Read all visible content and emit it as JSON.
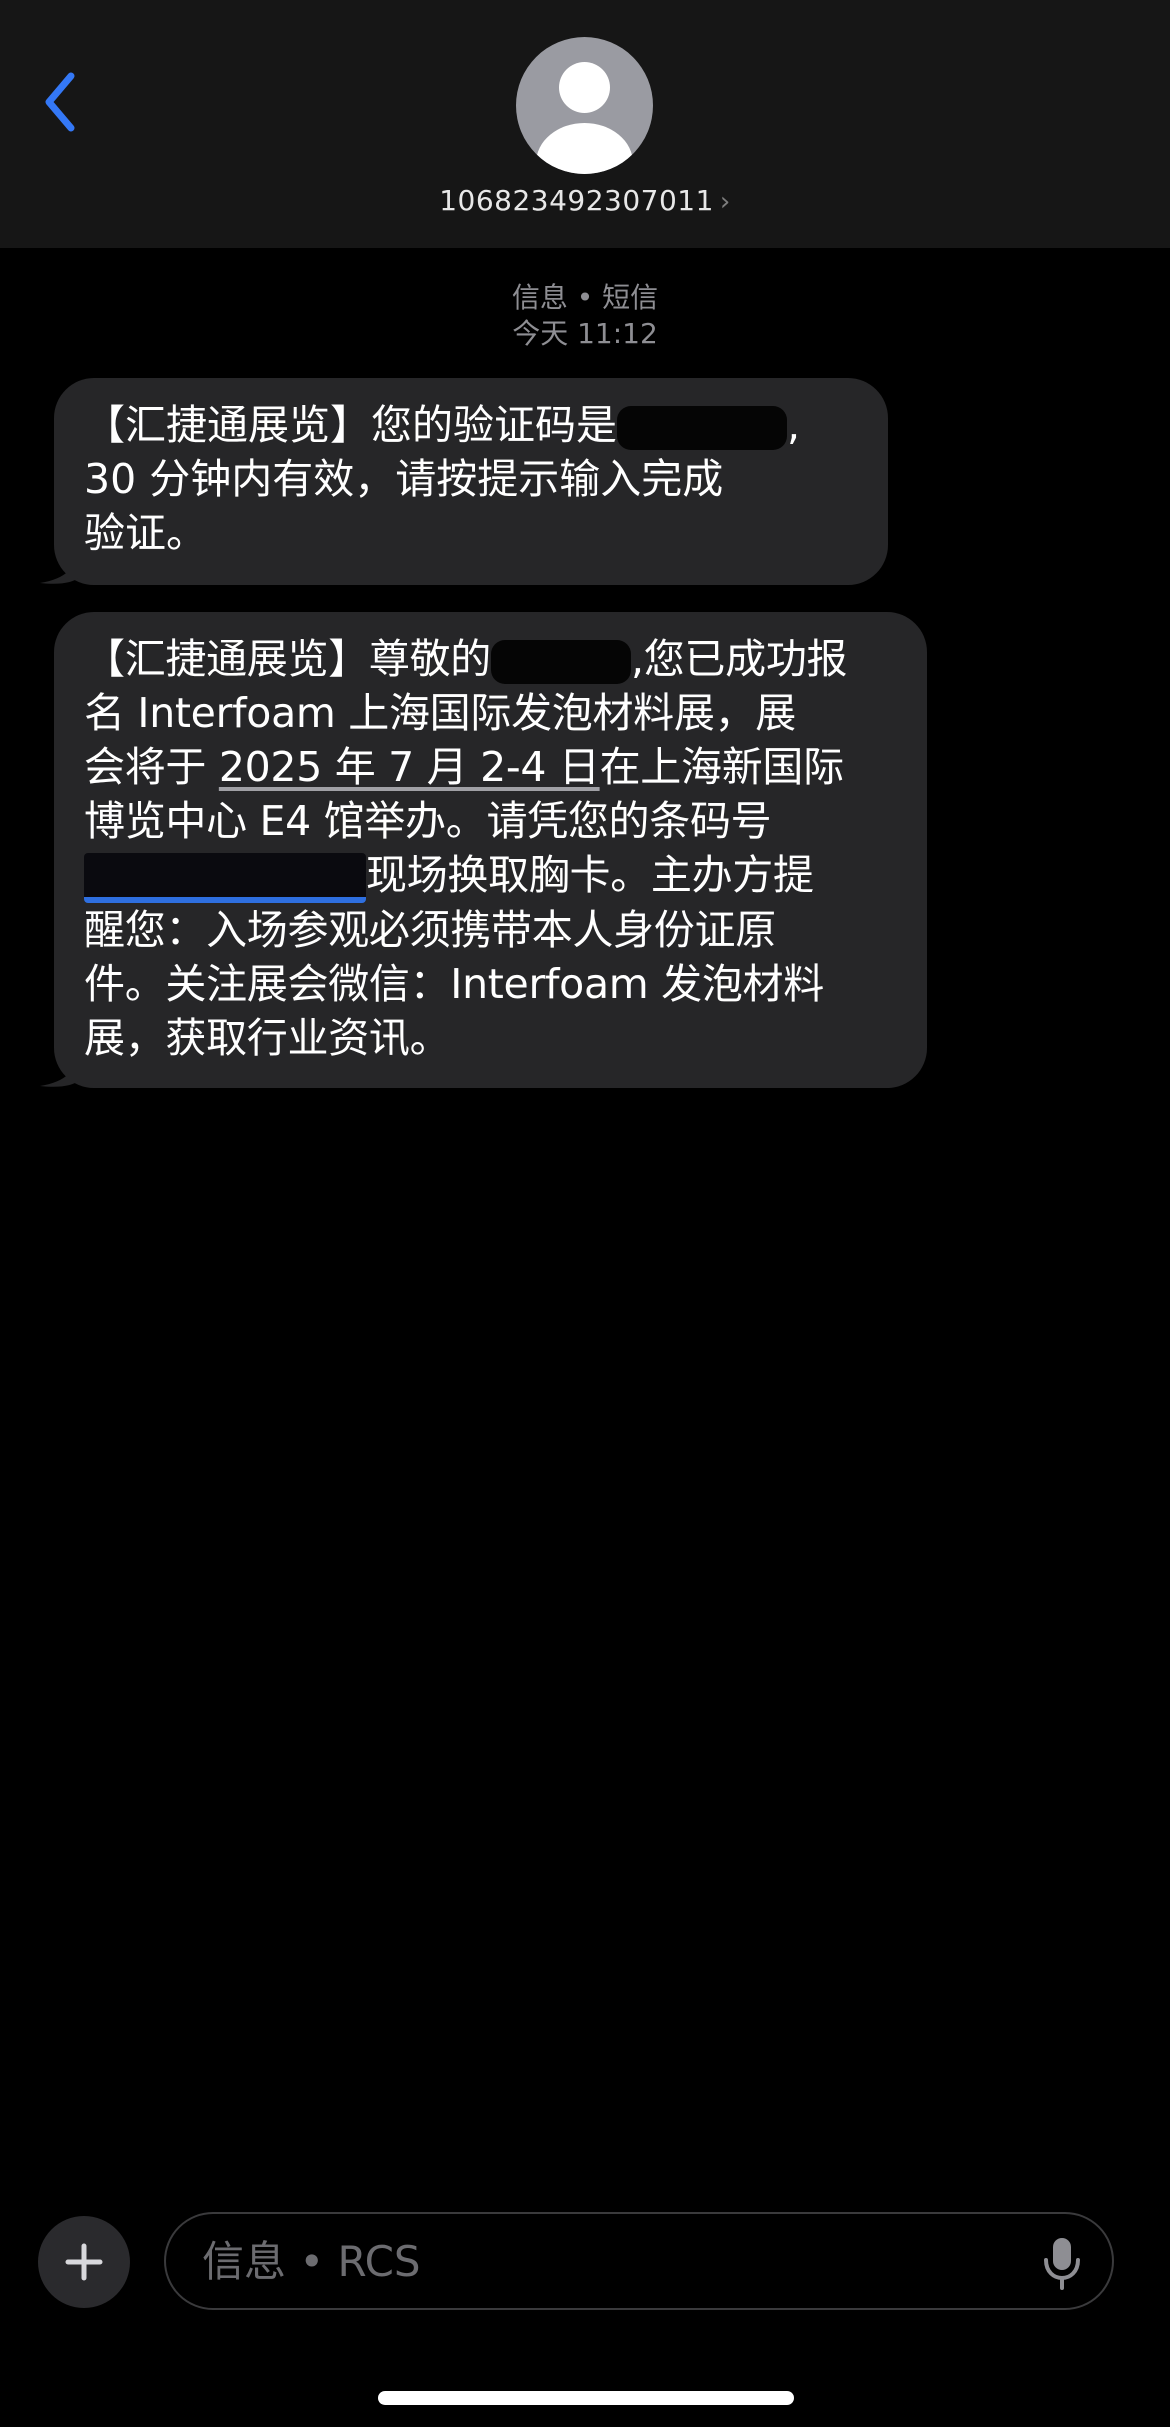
{
  "header": {
    "contact_name": "106823492307011",
    "chevron": "›",
    "back_icon": "chevron-left-icon",
    "avatar_icon": "person-silhouette-icon"
  },
  "thread": {
    "service_label": "信息 • 短信",
    "timestamp": "今天 11:12"
  },
  "messages": [
    {
      "line1_prefix": "【汇捷通展览】您的验证码是",
      "line1_suffix": ",",
      "line2": "30 分钟内有效，请按提示输入完成",
      "line3": "验证。"
    },
    {
      "l1_a": "【汇捷通展览】尊敬的",
      "l1_b": ",您已成功报",
      "l2": "名 Interfoam 上海国际发泡材料展，展",
      "l3_a": "会将于 ",
      "l3_date": "2025 年 7 月 2-4 日",
      "l3_b": "在上海新国际",
      "l4": "博览中心 E4 馆举办。请凭您的条码号",
      "l5_b": "现场换取胸卡。主办方提",
      "l6": "醒您：入场参观必须携带本人身份证原",
      "l7": "件。关注展会微信：Interfoam 发泡材料",
      "l8": "展，获取行业资讯。"
    }
  ],
  "compose": {
    "placeholder": "信息 • RCS",
    "plus_icon": "plus-icon",
    "mic_icon": "microphone-icon"
  },
  "colors": {
    "accent": "#3478F6",
    "bubble": "#262628",
    "header": "#161616"
  }
}
